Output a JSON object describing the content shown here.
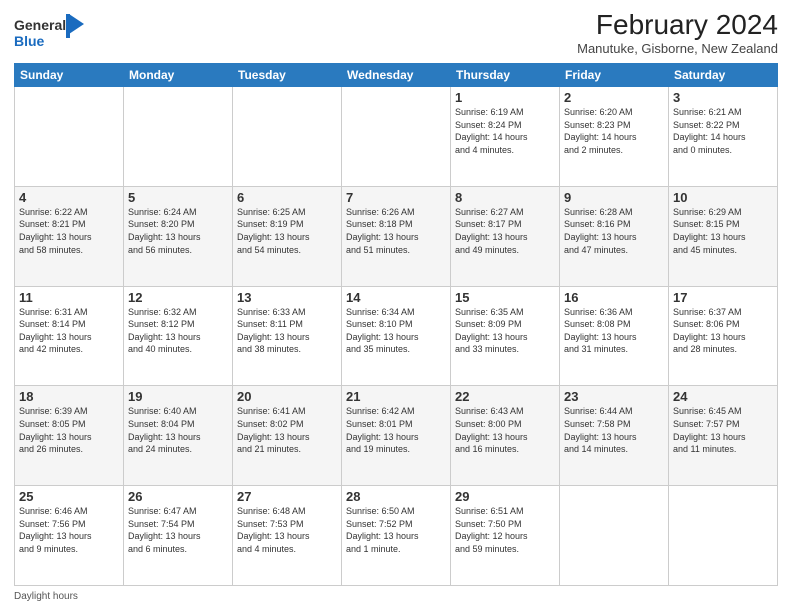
{
  "header": {
    "logo_general": "General",
    "logo_blue": "Blue",
    "title": "February 2024",
    "subtitle": "Manutuke, Gisborne, New Zealand"
  },
  "columns": [
    "Sunday",
    "Monday",
    "Tuesday",
    "Wednesday",
    "Thursday",
    "Friday",
    "Saturday"
  ],
  "weeks": [
    [
      {
        "day": "",
        "info": ""
      },
      {
        "day": "",
        "info": ""
      },
      {
        "day": "",
        "info": ""
      },
      {
        "day": "",
        "info": ""
      },
      {
        "day": "1",
        "info": "Sunrise: 6:19 AM\nSunset: 8:24 PM\nDaylight: 14 hours\nand 4 minutes."
      },
      {
        "day": "2",
        "info": "Sunrise: 6:20 AM\nSunset: 8:23 PM\nDaylight: 14 hours\nand 2 minutes."
      },
      {
        "day": "3",
        "info": "Sunrise: 6:21 AM\nSunset: 8:22 PM\nDaylight: 14 hours\nand 0 minutes."
      }
    ],
    [
      {
        "day": "4",
        "info": "Sunrise: 6:22 AM\nSunset: 8:21 PM\nDaylight: 13 hours\nand 58 minutes."
      },
      {
        "day": "5",
        "info": "Sunrise: 6:24 AM\nSunset: 8:20 PM\nDaylight: 13 hours\nand 56 minutes."
      },
      {
        "day": "6",
        "info": "Sunrise: 6:25 AM\nSunset: 8:19 PM\nDaylight: 13 hours\nand 54 minutes."
      },
      {
        "day": "7",
        "info": "Sunrise: 6:26 AM\nSunset: 8:18 PM\nDaylight: 13 hours\nand 51 minutes."
      },
      {
        "day": "8",
        "info": "Sunrise: 6:27 AM\nSunset: 8:17 PM\nDaylight: 13 hours\nand 49 minutes."
      },
      {
        "day": "9",
        "info": "Sunrise: 6:28 AM\nSunset: 8:16 PM\nDaylight: 13 hours\nand 47 minutes."
      },
      {
        "day": "10",
        "info": "Sunrise: 6:29 AM\nSunset: 8:15 PM\nDaylight: 13 hours\nand 45 minutes."
      }
    ],
    [
      {
        "day": "11",
        "info": "Sunrise: 6:31 AM\nSunset: 8:14 PM\nDaylight: 13 hours\nand 42 minutes."
      },
      {
        "day": "12",
        "info": "Sunrise: 6:32 AM\nSunset: 8:12 PM\nDaylight: 13 hours\nand 40 minutes."
      },
      {
        "day": "13",
        "info": "Sunrise: 6:33 AM\nSunset: 8:11 PM\nDaylight: 13 hours\nand 38 minutes."
      },
      {
        "day": "14",
        "info": "Sunrise: 6:34 AM\nSunset: 8:10 PM\nDaylight: 13 hours\nand 35 minutes."
      },
      {
        "day": "15",
        "info": "Sunrise: 6:35 AM\nSunset: 8:09 PM\nDaylight: 13 hours\nand 33 minutes."
      },
      {
        "day": "16",
        "info": "Sunrise: 6:36 AM\nSunset: 8:08 PM\nDaylight: 13 hours\nand 31 minutes."
      },
      {
        "day": "17",
        "info": "Sunrise: 6:37 AM\nSunset: 8:06 PM\nDaylight: 13 hours\nand 28 minutes."
      }
    ],
    [
      {
        "day": "18",
        "info": "Sunrise: 6:39 AM\nSunset: 8:05 PM\nDaylight: 13 hours\nand 26 minutes."
      },
      {
        "day": "19",
        "info": "Sunrise: 6:40 AM\nSunset: 8:04 PM\nDaylight: 13 hours\nand 24 minutes."
      },
      {
        "day": "20",
        "info": "Sunrise: 6:41 AM\nSunset: 8:02 PM\nDaylight: 13 hours\nand 21 minutes."
      },
      {
        "day": "21",
        "info": "Sunrise: 6:42 AM\nSunset: 8:01 PM\nDaylight: 13 hours\nand 19 minutes."
      },
      {
        "day": "22",
        "info": "Sunrise: 6:43 AM\nSunset: 8:00 PM\nDaylight: 13 hours\nand 16 minutes."
      },
      {
        "day": "23",
        "info": "Sunrise: 6:44 AM\nSunset: 7:58 PM\nDaylight: 13 hours\nand 14 minutes."
      },
      {
        "day": "24",
        "info": "Sunrise: 6:45 AM\nSunset: 7:57 PM\nDaylight: 13 hours\nand 11 minutes."
      }
    ],
    [
      {
        "day": "25",
        "info": "Sunrise: 6:46 AM\nSunset: 7:56 PM\nDaylight: 13 hours\nand 9 minutes."
      },
      {
        "day": "26",
        "info": "Sunrise: 6:47 AM\nSunset: 7:54 PM\nDaylight: 13 hours\nand 6 minutes."
      },
      {
        "day": "27",
        "info": "Sunrise: 6:48 AM\nSunset: 7:53 PM\nDaylight: 13 hours\nand 4 minutes."
      },
      {
        "day": "28",
        "info": "Sunrise: 6:50 AM\nSunset: 7:52 PM\nDaylight: 13 hours\nand 1 minute."
      },
      {
        "day": "29",
        "info": "Sunrise: 6:51 AM\nSunset: 7:50 PM\nDaylight: 12 hours\nand 59 minutes."
      },
      {
        "day": "",
        "info": ""
      },
      {
        "day": "",
        "info": ""
      }
    ]
  ],
  "footer": "Daylight hours"
}
